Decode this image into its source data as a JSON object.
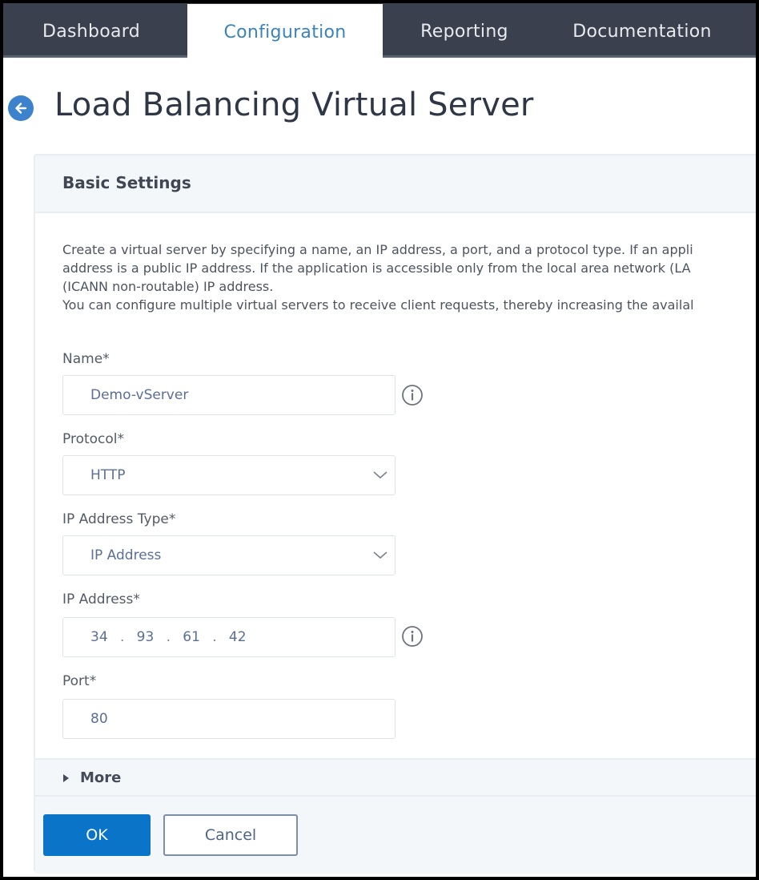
{
  "nav": {
    "tabs": [
      {
        "label": "Dashboard",
        "active": false
      },
      {
        "label": "Configuration",
        "active": true
      },
      {
        "label": "Reporting",
        "active": false
      },
      {
        "label": "Documentation",
        "active": false
      }
    ]
  },
  "page": {
    "back_icon": "arrow-left-circle-icon",
    "title": "Load Balancing Virtual Server"
  },
  "panel": {
    "title": "Basic Settings",
    "description": [
      "Create a virtual server by specifying a name, an IP address, a port, and a protocol type. If an appli",
      "address is a public IP address. If the application is accessible only from the local area network (LA",
      "(ICANN non-routable) IP address.",
      "You can configure multiple virtual servers to receive client requests, thereby increasing the availal"
    ],
    "fields": {
      "name": {
        "label": "Name*",
        "value": "Demo-vServer",
        "info_icon": "info-circle-icon"
      },
      "protocol": {
        "label": "Protocol*",
        "value": "HTTP",
        "dropdown_icon": "chevron-down-icon"
      },
      "ip_address_type": {
        "label": "IP Address Type*",
        "value": "IP Address",
        "dropdown_icon": "chevron-down-icon"
      },
      "ip_address": {
        "label": "IP Address*",
        "octets": [
          "34",
          "93",
          "61",
          "42"
        ],
        "separator": ".",
        "info_icon": "info-circle-icon"
      },
      "port": {
        "label": "Port*",
        "value": "80"
      }
    },
    "more": {
      "label": "More",
      "icon": "caret-right-icon"
    },
    "buttons": {
      "ok": "OK",
      "cancel": "Cancel"
    }
  },
  "colors": {
    "nav_bg": "#3a404d",
    "active_tab_text": "#3a83bd",
    "primary_button": "#0a74c8",
    "panel_header_bg": "#f4f7fa",
    "back_icon": "#3c82cc"
  }
}
